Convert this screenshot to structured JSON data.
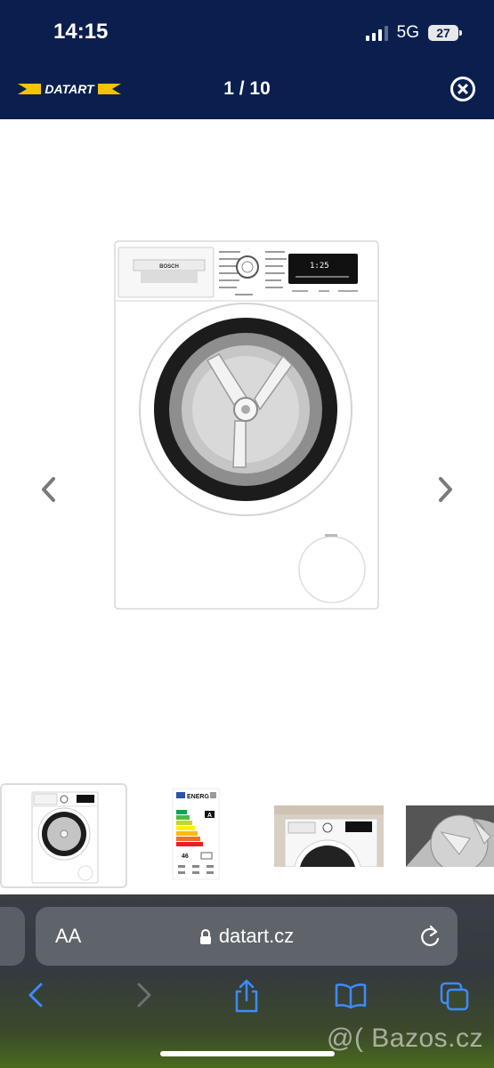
{
  "status_bar": {
    "time": "14:15",
    "network": "5G",
    "battery": "27"
  },
  "gallery": {
    "logo_text": "DATART",
    "counter": "1 / 10",
    "thumbnails": [
      {
        "label": "washer-front",
        "active": true
      },
      {
        "label": "energy-label",
        "active": false
      },
      {
        "label": "washer-installed",
        "active": false
      },
      {
        "label": "drum-closeup",
        "active": false
      }
    ]
  },
  "product_image": {
    "brand": "BOSCH",
    "display_value": "1:25"
  },
  "energy_label": {
    "header": "ENERG",
    "class": "A",
    "noise": "46"
  },
  "browser": {
    "aa_label": "AA",
    "url": "datart.cz"
  },
  "watermark": "@( Bazos.cz",
  "colors": {
    "header_bg": "#0b1f4e",
    "logo_yellow": "#f5c400",
    "ios_blue": "#3d8bfd"
  }
}
